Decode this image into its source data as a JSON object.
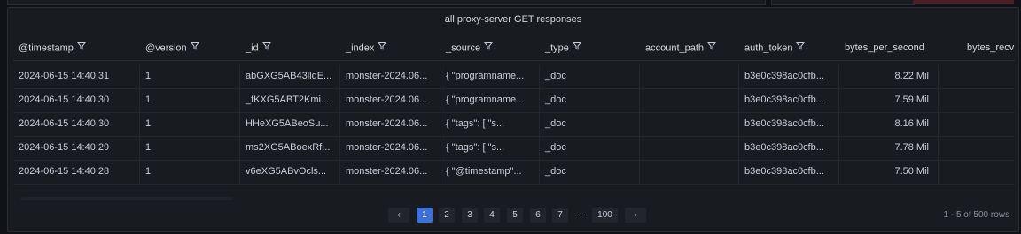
{
  "panel": {
    "title": "all proxy-server GET responses"
  },
  "table": {
    "columns": [
      "@timestamp",
      "@version",
      "_id",
      "_index",
      "_source",
      "_type",
      "account_path",
      "auth_token",
      "bytes_per_second",
      "bytes_recv"
    ],
    "rows": [
      [
        "2024-06-15 14:40:31",
        "1",
        "abGXG5AB43lldE...",
        "monster-2024.06...",
        "{ \"programname...",
        "_doc",
        "",
        "b3e0c398ac0cfb...",
        "8.22 Mil",
        ""
      ],
      [
        "2024-06-15 14:40:30",
        "1",
        "_fKXG5ABT2Kmi...",
        "monster-2024.06...",
        "{ \"programname...",
        "_doc",
        "",
        "b3e0c398ac0cfb...",
        "7.59 Mil",
        ""
      ],
      [
        "2024-06-15 14:40:30",
        "1",
        "HHeXG5ABeoSu...",
        "monster-2024.06...",
        "{ \"tags\": [ \"s...",
        "_doc",
        "",
        "b3e0c398ac0cfb...",
        "8.16 Mil",
        ""
      ],
      [
        "2024-06-15 14:40:29",
        "1",
        "ms2XG5ABoexRf...",
        "monster-2024.06...",
        "{ \"tags\": [ \"s...",
        "_doc",
        "",
        "b3e0c398ac0cfb...",
        "7.78 Mil",
        ""
      ],
      [
        "2024-06-15 14:40:28",
        "1",
        "v6eXG5ABvOcls...",
        "monster-2024.06...",
        "{ \"@timestamp\"...",
        "_doc",
        "",
        "b3e0c398ac0cfb...",
        "7.50 Mil",
        ""
      ]
    ]
  },
  "pagination": {
    "prev": "‹",
    "pages": [
      "1",
      "2",
      "3",
      "4",
      "5",
      "6",
      "7"
    ],
    "ellipsis": "···",
    "last": "100",
    "next": "›",
    "current": "1",
    "range_text": "1 - 5 of 500 rows"
  },
  "colors": {
    "background": "#111217",
    "panel": "#181b1f",
    "accent": "#3d71d9"
  },
  "icons": {
    "column_filter": "filter-icon"
  }
}
